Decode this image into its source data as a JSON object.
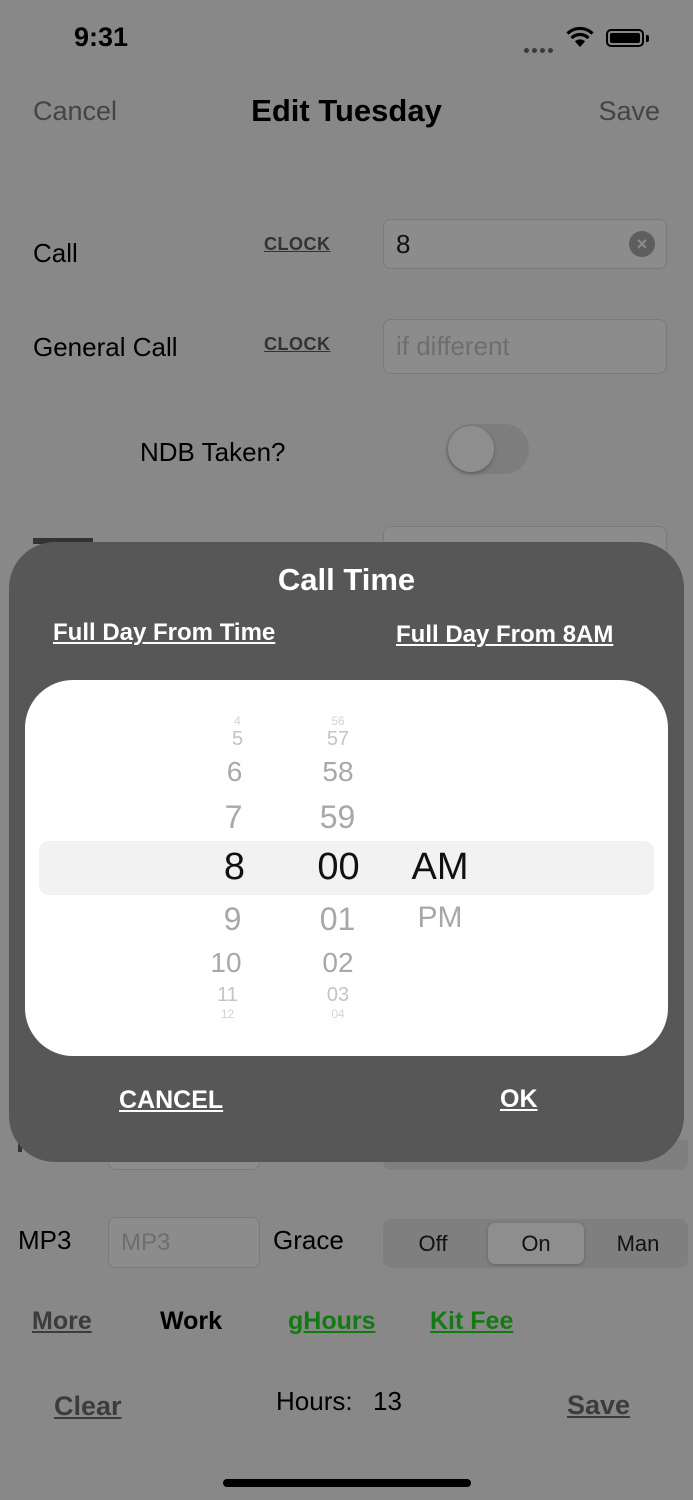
{
  "status_bar": {
    "time": "9:31"
  },
  "nav": {
    "cancel": "Cancel",
    "title": "Edit Tuesday",
    "save": "Save"
  },
  "rows": {
    "call": {
      "label": "Call",
      "clock": "CLOCK",
      "value": "8"
    },
    "general_call": {
      "label": "General Call",
      "clock": "CLOCK",
      "placeholder": "if different"
    },
    "ndb": {
      "label": "NDB Taken?",
      "on": false
    }
  },
  "lower": {
    "mp3_label": "MP3",
    "mp3_placeholder": "MP3",
    "grace_label": "Grace",
    "grace_options": [
      "Off",
      "On",
      "Man"
    ],
    "grace_selected": "On"
  },
  "links": {
    "more": "More",
    "work": "Work",
    "ghours": "gHours",
    "kit_fee": "Kit Fee"
  },
  "footer": {
    "clear": "Clear",
    "hours_label": "Hours:",
    "hours_value": "13",
    "save": "Save"
  },
  "modal": {
    "title": "Call Time",
    "link_left": "Full Day From Time",
    "link_right": "Full Day From 8AM",
    "picker": {
      "hours_above": [
        "4",
        "5",
        "6",
        "7"
      ],
      "hour_selected": "8",
      "hours_below": [
        "9",
        "10",
        "11",
        "12"
      ],
      "minutes_above": [
        "56",
        "57",
        "58",
        "59"
      ],
      "minute_selected": "00",
      "minutes_below": [
        "01",
        "02",
        "03",
        "04"
      ],
      "ampm_selected": "AM",
      "ampm_below": [
        "PM"
      ]
    },
    "cancel": "CANCEL",
    "ok": "OK"
  }
}
